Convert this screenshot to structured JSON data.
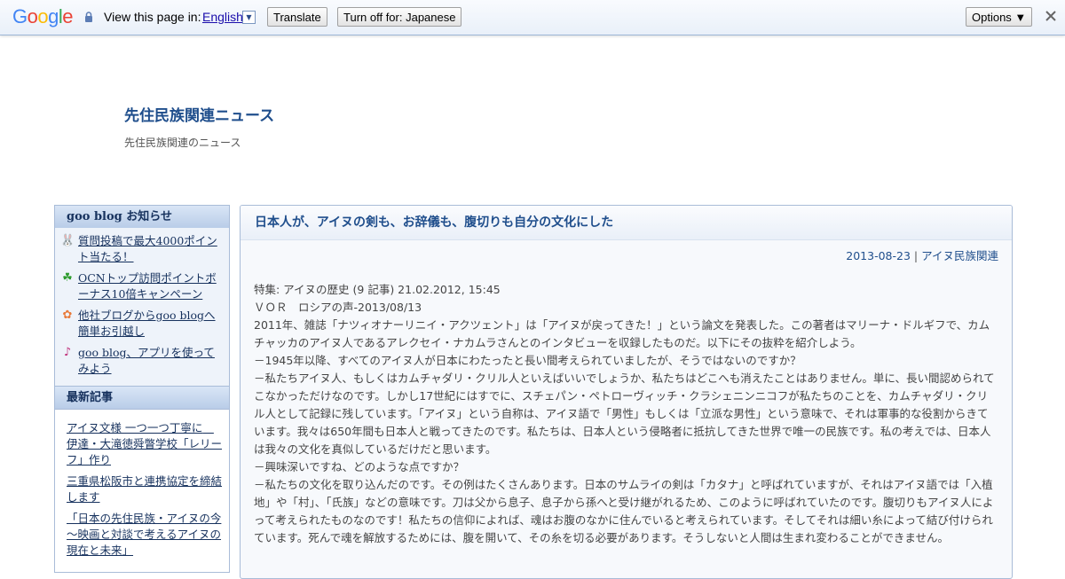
{
  "translate_bar": {
    "logo": "Google",
    "view_text": "View this page in:",
    "language": "English",
    "translate_label": "Translate",
    "turn_off_label": "Turn off for: Japanese",
    "options_label": "Options ▼"
  },
  "blog": {
    "title": "先住民族関連ニュース",
    "description": "先住民族関連のニュース"
  },
  "sidebar": {
    "notice_heading": "goo blog お知らせ",
    "notices": [
      {
        "icon": "rabbit-icon",
        "label": "質問投稿で最大4000ポイント当たる！"
      },
      {
        "icon": "clover-icon",
        "label": "OCNトップ訪問ポイントボーナス10倍キャンペーン"
      },
      {
        "icon": "flower-icon",
        "label": "他社ブログからgoo blogへ簡単お引越し"
      },
      {
        "icon": "music-note-icon",
        "label": "goo blog、アプリを使ってみよう"
      }
    ],
    "recent_heading": "最新記事",
    "recent": [
      "アイヌ文様 一つ一つ丁寧に　伊達・大滝徳舜瞥学校「レリーフ」作り",
      "三重県松阪市と連携協定を締結します",
      "「日本の先住民族・アイヌの今～映画と対談で考えるアイヌの現在と未来」"
    ]
  },
  "article": {
    "title": "日本人が、アイヌの剣も、お辞儀も、腹切りも自分の文化にした",
    "date": "2013-08-23",
    "separator": "|",
    "category": "アイヌ民族関連",
    "paragraphs": [
      "特集: アイヌの歴史 (9 記事) 21.02.2012, 15:45",
      "ＶＯＲ　ロシアの声-2013/08/13",
      "2011年、雑誌「ナツィオナーリニイ・アクツェント」は「アイヌが戻ってきた！」という論文を発表した。この著者はマリーナ・ドルギフで、カムチャッカのアイヌ人であるアレクセイ・ナカムラさんとのインタビューを収録したものだ。以下にその抜粋を紹介しよう。",
      "－1945年以降、すべてのアイヌ人が日本にわたったと長い間考えられていましたが、そうではないのですか？",
      "－私たちアイヌ人、もしくはカムチャダリ・クリル人といえばいいでしょうか、私たちはどこへも消えたことはありません。単に、長い間認められてこなかっただけなのです。しかし17世紀にはすでに、スチェパン・ペトローヴィッチ・クラシェニンニコフが私たちのことを、カムチャダリ・クリル人として記録に残しています。「アイヌ」という自称は、アイヌ語で「男性」もしくは「立派な男性」という意味で、それは軍事的な役割からきています。我々は650年間も日本人と戦ってきたのです。私たちは、日本人という侵略者に抵抗してきた世界で唯一の民族です。私の考えでは、日本人は我々の文化を真似しているだけだと思います。",
      "－興味深いですね、どのような点ですか？",
      "－私たちの文化を取り込んだのです。その例はたくさんあります。日本のサムライの剣は「カタナ」と呼ばれていますが、それはアイヌ語では「入植地」や「村」、「氏族」などの意味です。刀は父から息子、息子から孫へと受け継がれるため、このように呼ばれていたのです。腹切りもアイヌ人によって考えられたものなのです！私たちの信仰によれば、魂はお腹のなかに住んでいると考えられています。そしてそれは細い糸によって結び付けられています。死んで魂を解放するためには、腹を開いて、その糸を切る必要があります。そうしないと人間は生まれ変わることができません。"
    ]
  }
}
